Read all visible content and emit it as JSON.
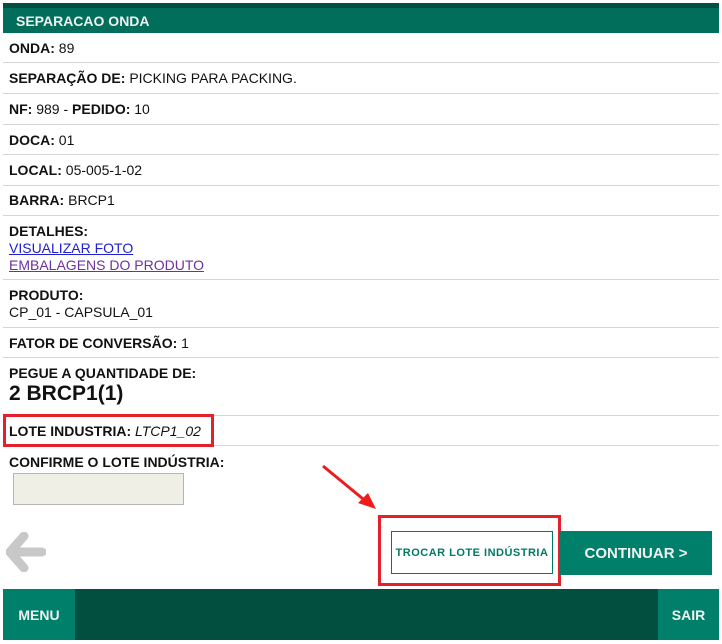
{
  "header": {
    "title": "SEPARACAO ONDA"
  },
  "fields": {
    "onda_label": "ONDA:",
    "onda": "89",
    "separacao_label": "SEPARAÇÃO DE:",
    "separacao": "PICKING PARA PACKING.",
    "nf_label": "NF:",
    "nf": "989",
    "sep": "-",
    "pedido_label": "PEDIDO:",
    "pedido": "10",
    "doca_label": "DOCA:",
    "doca": "01",
    "local_label": "LOCAL:",
    "local": "05-005-1-02",
    "barra_label": "BARRA:",
    "barra": "BRCP1",
    "detalhes_label": "DETALHES:",
    "link_foto": "VISUALIZAR FOTO",
    "link_embalagens": "EMBALAGENS DO PRODUTO",
    "produto_label": "PRODUTO:",
    "produto": "CP_01 - CAPSULA_01",
    "fator_label": "FATOR DE CONVERSÃO:",
    "fator": "1",
    "pegue_label": "PEGUE A QUANTIDADE DE:",
    "quantidade": "2 BRCP1(1)",
    "lote_label": "LOTE INDUSTRIA:",
    "lote": "LTCP1_02",
    "confirme_label": "CONFIRME O LOTE INDÚSTRIA:",
    "confirme_value": ""
  },
  "buttons": {
    "back_icon": "arrow-left-icon",
    "trocar": "TROCAR LOTE INDÚSTRIA",
    "continuar": "CONTINUAR >"
  },
  "footer": {
    "menu": "MENU",
    "sair": "SAIR"
  },
  "colors": {
    "primary": "#006e5a",
    "dark": "#024f3f",
    "highlight": "#e4202a"
  }
}
